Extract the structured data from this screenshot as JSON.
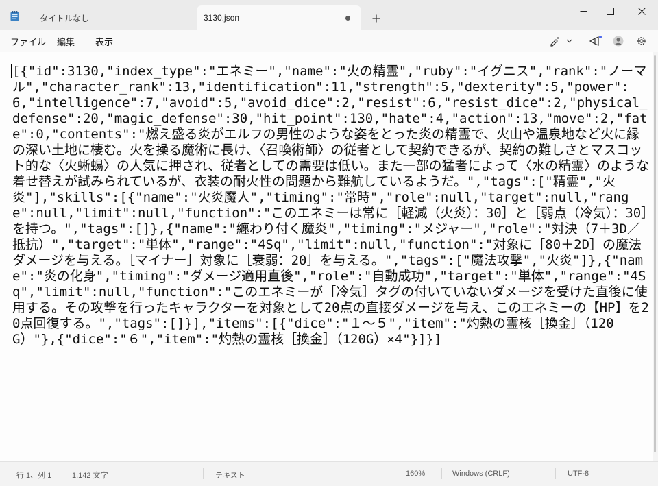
{
  "tabs": [
    {
      "label": "タイトルなし",
      "active": false
    },
    {
      "label": "3130.json",
      "active": true,
      "unsaved": true
    }
  ],
  "menu": {
    "file": "ファイル",
    "edit": "編集",
    "view": "表示"
  },
  "editor": {
    "content": "[{\"id\":3130,\"index_type\":\"エネミー\",\"name\":\"火の精霊\",\"ruby\":\"イグニス\",\"rank\":\"ノーマル\",\"character_rank\":13,\"identification\":11,\"strength\":5,\"dexterity\":5,\"power\":6,\"intelligence\":7,\"avoid\":5,\"avoid_dice\":2,\"resist\":6,\"resist_dice\":2,\"physical_defense\":20,\"magic_defense\":30,\"hit_point\":130,\"hate\":4,\"action\":13,\"move\":2,\"fate\":0,\"contents\":\"燃え盛る炎がエルフの男性のような姿をとった炎の精霊で、火山や温泉地など火に縁の深い土地に棲む。火を操る魔術に長け、〈召喚術師〉の従者として契約できるが、契約の難しさとマスコット的な〈火蜥蜴〉の人気に押され、従者としての需要は低い。また一部の猛者によって〈水の精霊〉のような着せ替えが試みられているが、衣装の耐火性の問題から難航しているようだ。\",\"tags\":[\"精霊\",\"火炎\"],\"skills\":[{\"name\":\"火炎魔人\",\"timing\":\"常時\",\"role\":null,\"target\":null,\"range\":null,\"limit\":null,\"function\":\"このエネミーは常に［軽減（火炎）：30］と［弱点（冷気）：30］を持つ。\",\"tags\":[]},{\"name\":\"纏わり付く魔炎\",\"timing\":\"メジャー\",\"role\":\"対決（7＋3D／抵抗）\",\"target\":\"単体\",\"range\":\"4Sq\",\"limit\":null,\"function\":\"対象に［80＋2D］の魔法ダメージを与える。［マイナー］対象に［衰弱：20］を与える。\",\"tags\":[\"魔法攻撃\",\"火炎\"]},{\"name\":\"炎の化身\",\"timing\":\"ダメージ適用直後\",\"role\":\"自動成功\",\"target\":\"単体\",\"range\":\"4Sq\",\"limit\":null,\"function\":\"このエネミーが［冷気］タグの付いていないダメージを受けた直後に使用する。その攻撃を行ったキャラクターを対象として20点の直接ダメージを与え、このエネミーの【HP】を20点回復する。\",\"tags\":[]}],\"items\":[{\"dice\":\"１～５\",\"item\":\"灼熱の霊核［換金］（120G）\"},{\"dice\":\"６\",\"item\":\"灼熱の霊核［換金］（120G）×4\"}]}]"
  },
  "status": {
    "position": "行 1、列 1",
    "char_count": "1,142 文字",
    "mode": "テキスト",
    "zoom": "160%",
    "line_ending": "Windows (CRLF)",
    "encoding": "UTF-8"
  }
}
